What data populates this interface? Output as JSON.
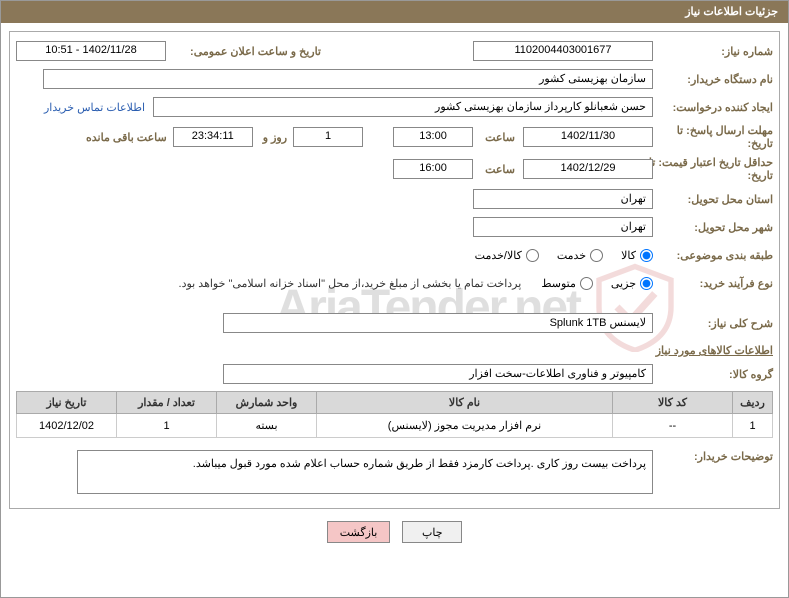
{
  "header": {
    "title": "جزئیات اطلاعات نیاز"
  },
  "fields": {
    "need_number_label": "شماره نیاز:",
    "need_number": "1102004403001677",
    "announce_label": "تاریخ و ساعت اعلان عمومی:",
    "announce_value": "1402/11/28 - 10:51",
    "buyer_org_label": "نام دستگاه خریدار:",
    "buyer_org": "سازمان بهزیستی کشور",
    "requester_label": "ایجاد کننده درخواست:",
    "requester": "حسن  شعبانلو کارپرداز سازمان بهزیستی کشور",
    "contact_link": "اطلاعات تماس خریدار",
    "deadline_label": "مهلت ارسال پاسخ: تا تاریخ:",
    "deadline_date": "1402/11/30",
    "time_word": "ساعت",
    "deadline_time": "13:00",
    "days": "1",
    "days_and": "روز و",
    "time_remaining": "23:34:11",
    "time_remaining_label": "ساعت باقی مانده",
    "validity_label": "حداقل تاریخ اعتبار قیمت: تا تاریخ:",
    "validity_date": "1402/12/29",
    "validity_time": "16:00",
    "province_label": "استان محل تحویل:",
    "province": "تهران",
    "city_label": "شهر محل تحویل:",
    "city": "تهران",
    "category_label": "طبقه بندی موضوعی:",
    "cat_goods": "کالا",
    "cat_service": "خدمت",
    "cat_both": "کالا/خدمت",
    "process_label": "نوع فرآیند خرید:",
    "proc_partial": "جزیی",
    "proc_medium": "متوسط",
    "payment_note": "پرداخت تمام یا بخشی از مبلغ خرید،از محل \"اسناد خزانه اسلامی\" خواهد بود.",
    "desc_label": "شرح کلی نیاز:",
    "desc_value": "لایسنس Splunk 1TB",
    "goods_header": "اطلاعات کالاهای مورد نیاز",
    "group_label": "گروه کالا:",
    "group_value": "کامپیوتر و فناوری اطلاعات-سخت افزار",
    "notes_label": "توضیحات خریدار:",
    "notes_value": "پرداخت بیست روز کاری .پرداخت کارمزد فقط از طریق شماره حساب اعلام شده مورد قبول میباشد."
  },
  "table": {
    "headers": {
      "row": "ردیف",
      "code": "کد کالا",
      "name": "نام کالا",
      "unit": "واحد شمارش",
      "qty": "تعداد / مقدار",
      "date": "تاریخ نیاز"
    },
    "rows": [
      {
        "row": "1",
        "code": "--",
        "name": "نرم افزار مدیریت مجوز (لایسنس)",
        "unit": "بسته",
        "qty": "1",
        "date": "1402/12/02"
      }
    ]
  },
  "buttons": {
    "print": "چاپ",
    "back": "بازگشت"
  },
  "watermark": "AriaTender.net"
}
